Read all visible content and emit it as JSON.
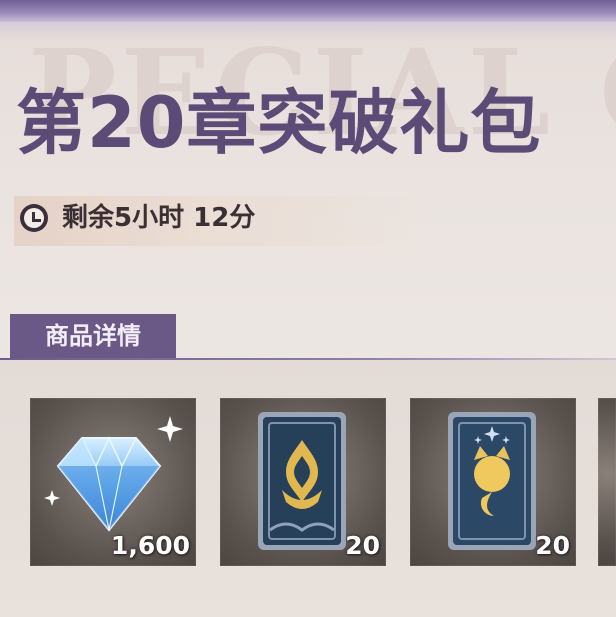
{
  "header": {
    "watermark": "PECIAL O",
    "title": "第20章突破礼包"
  },
  "timer": {
    "icon": "clock-icon",
    "text": "剩余5小时 12分"
  },
  "section": {
    "tab_label": "商品详情"
  },
  "items": [
    {
      "icon": "diamond-icon",
      "quantity": "1,600"
    },
    {
      "icon": "card-back-crest-icon",
      "quantity": "20"
    },
    {
      "icon": "card-back-fox-icon",
      "quantity": "20"
    }
  ],
  "colors": {
    "title": "#5c4b76",
    "tab_bg": "#6a5886",
    "top_bar": "#6f5f93"
  }
}
